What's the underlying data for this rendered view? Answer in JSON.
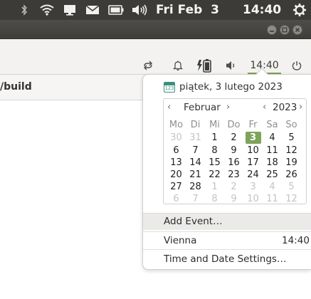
{
  "top_panel": {
    "date": "Fri Feb  3",
    "time": "14:40",
    "icons": [
      "wifi-icon",
      "monitor-icon",
      "mail-icon",
      "battery-icon",
      "volume-icon",
      "gear-icon"
    ]
  },
  "toolbar": {
    "time": "14:40",
    "icons": [
      "sync-icon",
      "bell-icon",
      "battery-charging-icon",
      "volume-icon",
      "power-icon"
    ]
  },
  "path_bar": {
    "text": "/build"
  },
  "popup": {
    "date_header": "piątek, 3 lutego 2023",
    "calendar_icon_text": "123",
    "month": "Februar",
    "year": "2023",
    "weekdays": [
      "Mo",
      "Di",
      "Mi",
      "Do",
      "Fr",
      "Sa",
      "So"
    ],
    "weeks": [
      [
        {
          "d": "30",
          "o": true
        },
        {
          "d": "31",
          "o": true
        },
        {
          "d": "1"
        },
        {
          "d": "2"
        },
        {
          "d": "3",
          "today": true
        },
        {
          "d": "4"
        },
        {
          "d": "5"
        }
      ],
      [
        {
          "d": "6"
        },
        {
          "d": "7"
        },
        {
          "d": "8"
        },
        {
          "d": "9"
        },
        {
          "d": "10"
        },
        {
          "d": "11"
        },
        {
          "d": "12"
        }
      ],
      [
        {
          "d": "13"
        },
        {
          "d": "14"
        },
        {
          "d": "15"
        },
        {
          "d": "16"
        },
        {
          "d": "17"
        },
        {
          "d": "18"
        },
        {
          "d": "19"
        }
      ],
      [
        {
          "d": "20"
        },
        {
          "d": "21"
        },
        {
          "d": "22"
        },
        {
          "d": "23"
        },
        {
          "d": "24"
        },
        {
          "d": "25"
        },
        {
          "d": "26"
        }
      ],
      [
        {
          "d": "27"
        },
        {
          "d": "28"
        },
        {
          "d": "1",
          "o": true
        },
        {
          "d": "2",
          "o": true
        },
        {
          "d": "3",
          "o": true
        },
        {
          "d": "4",
          "o": true
        },
        {
          "d": "5",
          "o": true
        }
      ],
      [
        {
          "d": "6",
          "o": true
        },
        {
          "d": "7",
          "o": true
        },
        {
          "d": "8",
          "o": true
        },
        {
          "d": "9",
          "o": true
        },
        {
          "d": "10",
          "o": true
        },
        {
          "d": "11",
          "o": true
        },
        {
          "d": "12",
          "o": true
        }
      ]
    ],
    "add_event": "Add Event…",
    "location": "Vienna",
    "location_time": "14:40",
    "settings": "Time and Date Settings…"
  },
  "colors": {
    "panel_bg": "#3c3b37",
    "accent": "#7ea35a",
    "today_bg": "#7ea35a"
  }
}
